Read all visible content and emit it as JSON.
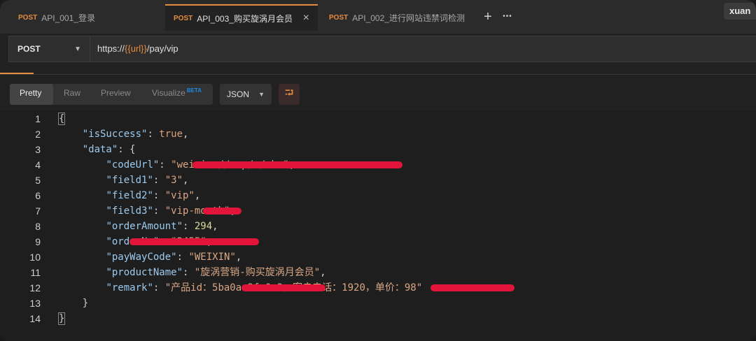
{
  "tabs": [
    {
      "method": "POST",
      "name": "API_001_登录"
    },
    {
      "method": "POST",
      "name": "API_003_购买旋涡月会员"
    },
    {
      "method": "POST",
      "name": "API_002_进行网站违禁词检测"
    }
  ],
  "tab_controls": {
    "close": "×",
    "add": "+",
    "more": "•••"
  },
  "user": "xuan",
  "request": {
    "method": "POST",
    "url_prefix": "https://",
    "url_var": "{{url}}",
    "url_suffix": "/pay/vip"
  },
  "view": {
    "options": [
      "Pretty",
      "Raw",
      "Preview",
      "Visualize"
    ],
    "beta": "BETA",
    "active": "Pretty",
    "format": "JSON"
  },
  "lines": [
    "1",
    "2",
    "3",
    "4",
    "5",
    "6",
    "7",
    "8",
    "9",
    "10",
    "11",
    "12",
    "13",
    "14"
  ],
  "json": {
    "isSuccess": "true",
    "codeUrl": "\"weixin://wxp/u/xhw\"",
    "field1": "\"3\"",
    "field2": "\"vip\"",
    "field3": "\"vip-month\"",
    "orderAmount": "294",
    "orderNo": "\"2455\"",
    "payWayCode": "\"WEIXIN\"",
    "productName": "\"旋涡营销-购买旋涡月会员\"",
    "remark": "\"产品id：5ba0ac3fe0c3，客户电话：1920，单价：98\""
  },
  "colors": {
    "accent": "#e58d3f",
    "key": "#9ccbf0",
    "string": "#dba785",
    "number": "#d8dca0",
    "redaction": "#e2143a"
  }
}
